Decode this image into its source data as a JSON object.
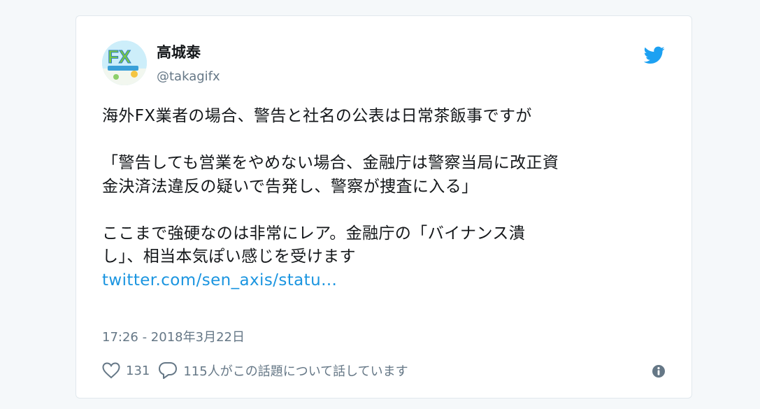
{
  "author": {
    "display_name": "高城泰",
    "handle": "@takagifx",
    "avatar_text": "FX"
  },
  "tweet": {
    "paragraph_1": "海外FX業者の場合、警告と社名の公表は日常茶飯事ですが",
    "paragraph_2_line_1": "「警告しても営業をやめない場合、金融庁は警察当局に改正資",
    "paragraph_2_line_2": "金決済法違反の疑いで告発し、警察が捜査に入る」",
    "paragraph_3_line_1": "ここまで強硬なのは非常にレア。金融庁の「バイナンス潰",
    "paragraph_3_line_2": "し」、相当本気ぽい感じを受けます",
    "link_text": "twitter.com/sen_axis/statu…",
    "timestamp": "17:26 - 2018年3月22日"
  },
  "actions": {
    "like_count": "131",
    "reply_label": "115人がこの話題について話しています"
  },
  "colors": {
    "link": "#1b95e0",
    "twitter_blue": "#1da1f2",
    "muted": "#657786",
    "text": "#14171a"
  },
  "icons": [
    "twitter-bird-icon",
    "heart-icon",
    "reply-bubble-icon",
    "info-icon"
  ]
}
